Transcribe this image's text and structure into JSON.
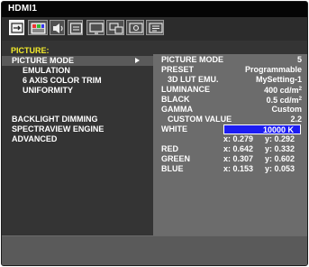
{
  "input": {
    "label": "HDMI1"
  },
  "tabs": [
    {
      "icon": "input-icon"
    },
    {
      "icon": "picture-icon"
    },
    {
      "icon": "audio-icon"
    },
    {
      "icon": "schedule-icon"
    },
    {
      "icon": "display-icon"
    },
    {
      "icon": "multi-input-icon"
    },
    {
      "icon": "protect-icon"
    },
    {
      "icon": "system-icon"
    }
  ],
  "menu": {
    "section_title": "PICTURE:",
    "items": [
      {
        "label": "PICTURE MODE"
      },
      {
        "label": "EMULATION"
      },
      {
        "label": "6 AXIS COLOR TRIM"
      },
      {
        "label": "UNIFORMITY"
      },
      {
        "label": "BACKLIGHT DIMMING"
      },
      {
        "label": "SPECTRAVIEW ENGINE"
      },
      {
        "label": "ADVANCED"
      }
    ]
  },
  "panel": {
    "picture_mode": {
      "label": "PICTURE MODE",
      "value": "5"
    },
    "preset": {
      "label": "PRESET",
      "value": "Programmable"
    },
    "lut": {
      "label": "3D LUT EMU.",
      "value": "MySetting-1"
    },
    "luminance": {
      "label": "LUMINANCE",
      "value": "400 cd/m",
      "unit_sup": "2"
    },
    "black": {
      "label": "BLACK",
      "value": "0.5 cd/m",
      "unit_sup": "2"
    },
    "gamma": {
      "label": "GAMMA",
      "value": "Custom"
    },
    "custom_value": {
      "label": "CUSTOM VALUE",
      "value": "2.2"
    },
    "white": {
      "label": "WHITE",
      "value": "10000 K",
      "x": "x: 0.279",
      "y": "y: 0.292"
    },
    "red": {
      "label": "RED",
      "x": "x: 0.642",
      "y": "y: 0.332"
    },
    "green": {
      "label": "GREEN",
      "x": "x: 0.307",
      "y": "y: 0.602"
    },
    "blue": {
      "label": "BLUE",
      "x": "x: 0.153",
      "y": "y: 0.053"
    }
  },
  "colors": {
    "section_title": "#f4ec2a",
    "white_highlight": "#1c1cf2"
  }
}
